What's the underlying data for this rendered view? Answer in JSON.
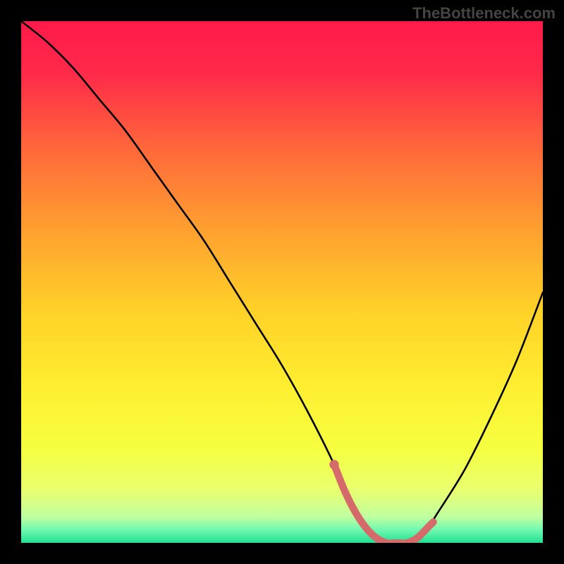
{
  "watermark": "TheBottleneck.com",
  "chart_data": {
    "type": "line",
    "title": "",
    "xlabel": "",
    "ylabel": "",
    "xlim": [
      0,
      100
    ],
    "ylim": [
      0,
      100
    ],
    "series": [
      {
        "name": "bottleneck-curve",
        "x": [
          0,
          5,
          10,
          15,
          20,
          25,
          30,
          35,
          40,
          45,
          50,
          55,
          60,
          62,
          64,
          66,
          68,
          70,
          72,
          74,
          76,
          78,
          80,
          85,
          90,
          95,
          100
        ],
        "values": [
          100,
          96,
          91,
          85,
          79,
          72,
          65,
          58,
          50,
          42,
          34,
          25,
          15,
          10,
          6,
          3,
          1,
          0,
          0,
          0,
          1,
          3,
          6,
          14,
          24,
          35,
          48
        ]
      },
      {
        "name": "highlight-segment",
        "color": "#d46a6a",
        "x": [
          60,
          62,
          64,
          66,
          68,
          70,
          72,
          74,
          76,
          78,
          79
        ],
        "values": [
          15,
          10,
          6,
          3,
          1,
          0,
          0,
          0,
          1,
          3,
          4
        ]
      }
    ],
    "background_gradient_stops": [
      {
        "pos": 0.0,
        "color": "#ff1a4a"
      },
      {
        "pos": 0.1,
        "color": "#ff2a4a"
      },
      {
        "pos": 0.25,
        "color": "#ff6a3a"
      },
      {
        "pos": 0.4,
        "color": "#ffa030"
      },
      {
        "pos": 0.55,
        "color": "#ffd028"
      },
      {
        "pos": 0.7,
        "color": "#ffee30"
      },
      {
        "pos": 0.82,
        "color": "#f5ff40"
      },
      {
        "pos": 0.9,
        "color": "#e8ff70"
      },
      {
        "pos": 0.95,
        "color": "#c0ffa0"
      },
      {
        "pos": 0.975,
        "color": "#70f8b0"
      },
      {
        "pos": 1.0,
        "color": "#20e090"
      }
    ]
  }
}
